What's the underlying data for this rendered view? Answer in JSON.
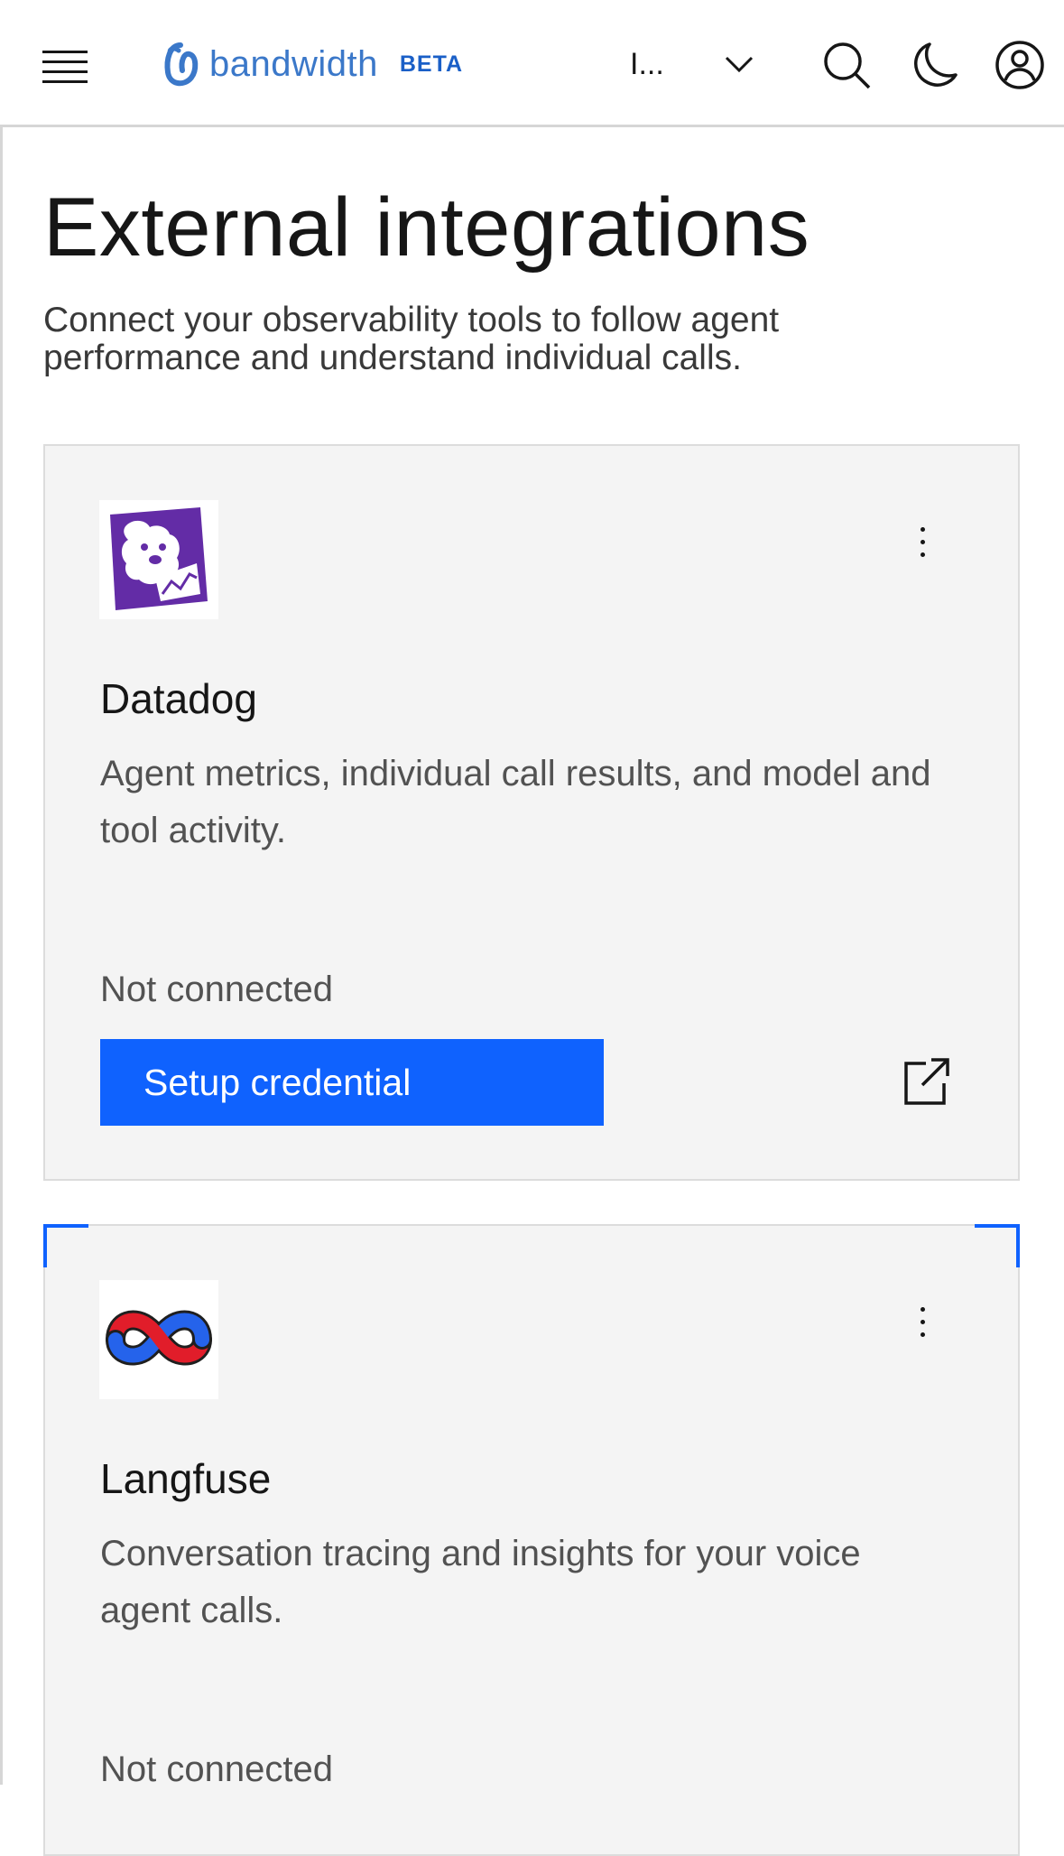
{
  "header": {
    "logo_text": "bandwidth",
    "badge": "BETA",
    "workspace_label": "I...",
    "icons": [
      "menu-icon",
      "chevron-down-icon",
      "search-icon",
      "moon-icon",
      "user-avatar-icon"
    ]
  },
  "page": {
    "title": "External integrations",
    "subtitle": "Connect your observability tools to follow agent performance and understand individual calls."
  },
  "integrations": [
    {
      "name": "Datadog",
      "description": "Agent metrics, individual call results, and model and tool activity.",
      "status": "Not connected",
      "action_label": "Setup credential",
      "logo": "datadog-logo",
      "brand_color": "#632ca6"
    },
    {
      "name": "Langfuse",
      "description": "Conversation tracing and insights for your voice agent calls.",
      "status": "Not connected",
      "logo": "langfuse-logo",
      "brand_colors": [
        "#e11d2a",
        "#2563eb"
      ]
    }
  ],
  "colors": {
    "primary": "#0f62fe",
    "brand_text": "#3b78c9",
    "card_bg": "#f4f4f4"
  }
}
